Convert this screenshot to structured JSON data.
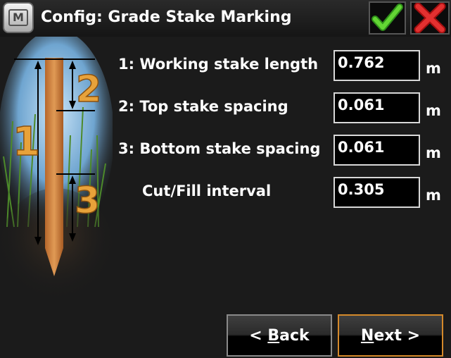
{
  "window": {
    "title": "Config: Grade Stake Marking",
    "menu_icon_letter": "M"
  },
  "diagram": {
    "labels": [
      "1",
      "2",
      "3"
    ]
  },
  "fields": [
    {
      "label": "1: Working stake length",
      "value": "0.762",
      "unit": "m"
    },
    {
      "label": "2: Top stake spacing",
      "value": "0.061",
      "unit": "m"
    },
    {
      "label": "3: Bottom stake spacing",
      "value": "0.061",
      "unit": "m"
    },
    {
      "label": "Cut/Fill interval",
      "value": "0.305",
      "unit": "m"
    }
  ],
  "buttons": {
    "back_prefix": "< ",
    "back_mnemonic": "B",
    "back_rest": "ack",
    "next_mnemonic": "N",
    "next_rest": "ext >"
  },
  "colors": {
    "accent_orange": "#d5892a",
    "ok_green": "#4fbf25",
    "cancel_red": "#d42222"
  }
}
